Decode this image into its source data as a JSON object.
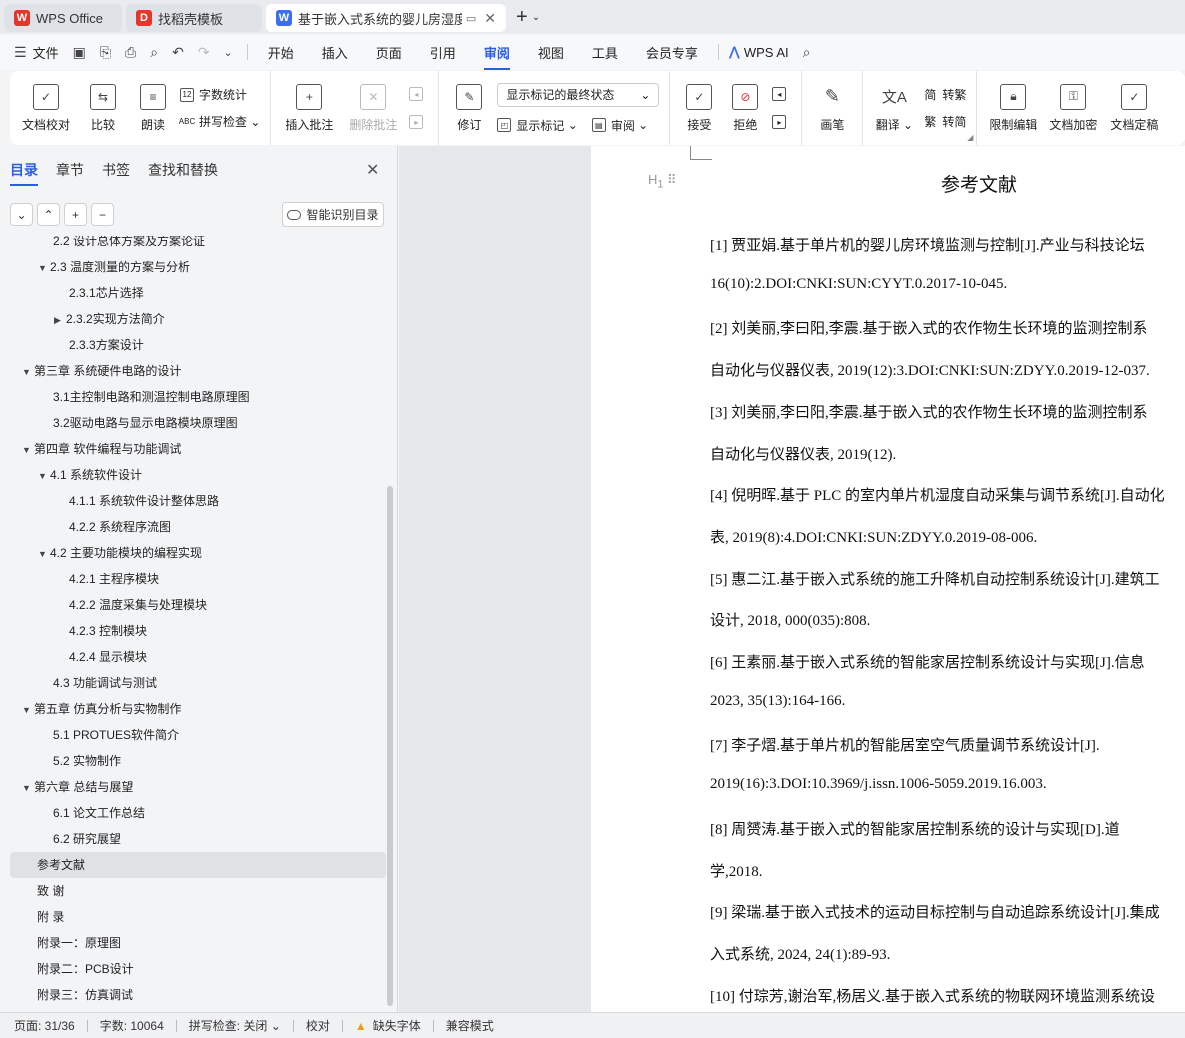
{
  "tabs": [
    {
      "label": "WPS Office",
      "logo": "W",
      "color": "#e8352b"
    },
    {
      "label": "找稻壳模板",
      "logo": "D",
      "color": "#e8352b"
    },
    {
      "label": "基于嵌入式系统的婴儿房湿度E",
      "logo": "W",
      "color": "#3b6ff0"
    }
  ],
  "menu": {
    "file": "文件",
    "tabs": [
      "开始",
      "插入",
      "页面",
      "引用",
      "审阅",
      "视图",
      "工具",
      "会员专享"
    ],
    "active": "审阅",
    "ai": "WPS AI"
  },
  "ribbon": {
    "doc_check": "文档校对",
    "compare": "比较",
    "read_aloud": "朗读",
    "word_count": "字数统计",
    "spell_check": "拼写检查",
    "insert_comment": "插入批注",
    "delete_comment": "删除批注",
    "revise": "修订",
    "markup_select": "显示标记的最终状态",
    "show_markup": "显示标记",
    "review": "审阅",
    "accept": "接受",
    "reject": "拒绝",
    "pen": "画笔",
    "translate": "翻译",
    "to_traditional": "转繁",
    "to_simplified": "转简",
    "restrict_edit": "限制编辑",
    "encrypt": "文档加密",
    "finalize": "文档定稿"
  },
  "nav": {
    "tabs": [
      "目录",
      "章节",
      "书签",
      "查找和替换"
    ],
    "smart_button": "智能识别目录",
    "toc": [
      {
        "text": "2.2  设计总体方案及方案论证",
        "cls": "lv2n",
        "arrow": ""
      },
      {
        "text": "2.3  温度测量的方案与分析",
        "cls": "lv2",
        "arrow": "▼"
      },
      {
        "text": "2.3.1芯片选择",
        "cls": "lv3n",
        "arrow": ""
      },
      {
        "text": "2.3.2实现方法简介",
        "cls": "lv3",
        "arrow": "▶"
      },
      {
        "text": "2.3.3方案设计",
        "cls": "lv3n",
        "arrow": ""
      },
      {
        "text": "第三章  系统硬件电路的设计",
        "cls": "lv1",
        "arrow": "▼"
      },
      {
        "text": "3.1主控制电路和测温控制电路原理图",
        "cls": "lv2n",
        "arrow": ""
      },
      {
        "text": "3.2驱动电路与显示电路模块原理图",
        "cls": "lv2n",
        "arrow": ""
      },
      {
        "text": "第四章  软件编程与功能调试",
        "cls": "lv1",
        "arrow": "▼"
      },
      {
        "text": "4.1  系统软件设计",
        "cls": "lv2",
        "arrow": "▼"
      },
      {
        "text": "4.1.1  系统软件设计整体思路",
        "cls": "lv3n",
        "arrow": ""
      },
      {
        "text": "4.2.2  系统程序流图",
        "cls": "lv3n",
        "arrow": ""
      },
      {
        "text": "4.2  主要功能模块的编程实现",
        "cls": "lv2",
        "arrow": "▼"
      },
      {
        "text": "4.2.1  主程序模块",
        "cls": "lv3n",
        "arrow": ""
      },
      {
        "text": "4.2.2  温度采集与处理模块",
        "cls": "lv3n",
        "arrow": ""
      },
      {
        "text": "4.2.3  控制模块",
        "cls": "lv3n",
        "arrow": ""
      },
      {
        "text": "4.2.4  显示模块",
        "cls": "lv3n",
        "arrow": ""
      },
      {
        "text": "4.3  功能调试与测试",
        "cls": "lv2n",
        "arrow": ""
      },
      {
        "text": "第五章  仿真分析与实物制作",
        "cls": "lv1",
        "arrow": "▼"
      },
      {
        "text": "5.1 PROTUES软件简介",
        "cls": "lv2n",
        "arrow": ""
      },
      {
        "text": "5.2  实物制作",
        "cls": "lv2n",
        "arrow": ""
      },
      {
        "text": "第六章  总结与展望",
        "cls": "lv1",
        "arrow": "▼"
      },
      {
        "text": "6.1  论文工作总结",
        "cls": "lv2n",
        "arrow": ""
      },
      {
        "text": "6.2  研究展望",
        "cls": "lv2n",
        "arrow": ""
      },
      {
        "text": "参考文献",
        "cls": "lv1n",
        "arrow": "",
        "selected": true
      },
      {
        "text": "致    谢",
        "cls": "lv1n",
        "arrow": ""
      },
      {
        "text": "附    录",
        "cls": "lv1n",
        "arrow": ""
      },
      {
        "text": "附录一：原理图",
        "cls": "lv1n",
        "arrow": ""
      },
      {
        "text": "附录二：PCB设计",
        "cls": "lv1n",
        "arrow": ""
      },
      {
        "text": "附录三：仿真调试",
        "cls": "lv1n",
        "arrow": ""
      }
    ]
  },
  "document": {
    "heading_mark": "H",
    "title": "参考文献",
    "lines": [
      "[1]  贾亚娟.基于单片机的婴儿房环境监测与控制[J].产业与科技论坛",
      "16(10):2.DOI:CNKI:SUN:CYYT.0.2017-10-045.",
      "[2]  刘美丽,李曰阳,李震.基于嵌入式的农作物生长环境的监测控制系",
      "自动化与仪器仪表, 2019(12):3.DOI:CNKI:SUN:ZDYY.0.2019-12-037.",
      "[3]  刘美丽,李曰阳,李震.基于嵌入式的农作物生长环境的监测控制系",
      "自动化与仪器仪表, 2019(12).",
      "[4]  倪明晖.基于 PLC 的室内单片机湿度自动采集与调节系统[J].自动化",
      "表, 2019(8):4.DOI:CNKI:SUN:ZDYY.0.2019-08-006.",
      "[5]  惠二江.基于嵌入式系统的施工升降机自动控制系统设计[J].建筑工",
      "设计, 2018, 000(035):808.",
      "[6]  王素丽.基于嵌入式系统的智能家居控制系统设计与实现[J].信息",
      "2023, 35(13):164-166.",
      "[7]  李子熠.基于单片机的智能居室空气质量调节系统设计[J].",
      "2019(16):3.DOI:10.3969/j.issn.1006-5059.2019.16.003.",
      "[8]  周赟涛.基于嵌入式的智能家居控制系统的设计与实现[D].道",
      "学,2018.",
      "[9]  梁瑞.基于嵌入式技术的运动目标控制与自动追踪系统设计[J].集成",
      "入式系统, 2024, 24(1):89-93.",
      "[10]  付琮芳,谢治军,杨居义.基于嵌入式系统的物联网环境监测系统设"
    ]
  },
  "status": {
    "page": "页面: 31/36",
    "words": "字数: 10064",
    "spell": "拼写检查: 关闭",
    "proof": "校对",
    "missing_font": "缺失字体",
    "compat": "兼容模式"
  }
}
